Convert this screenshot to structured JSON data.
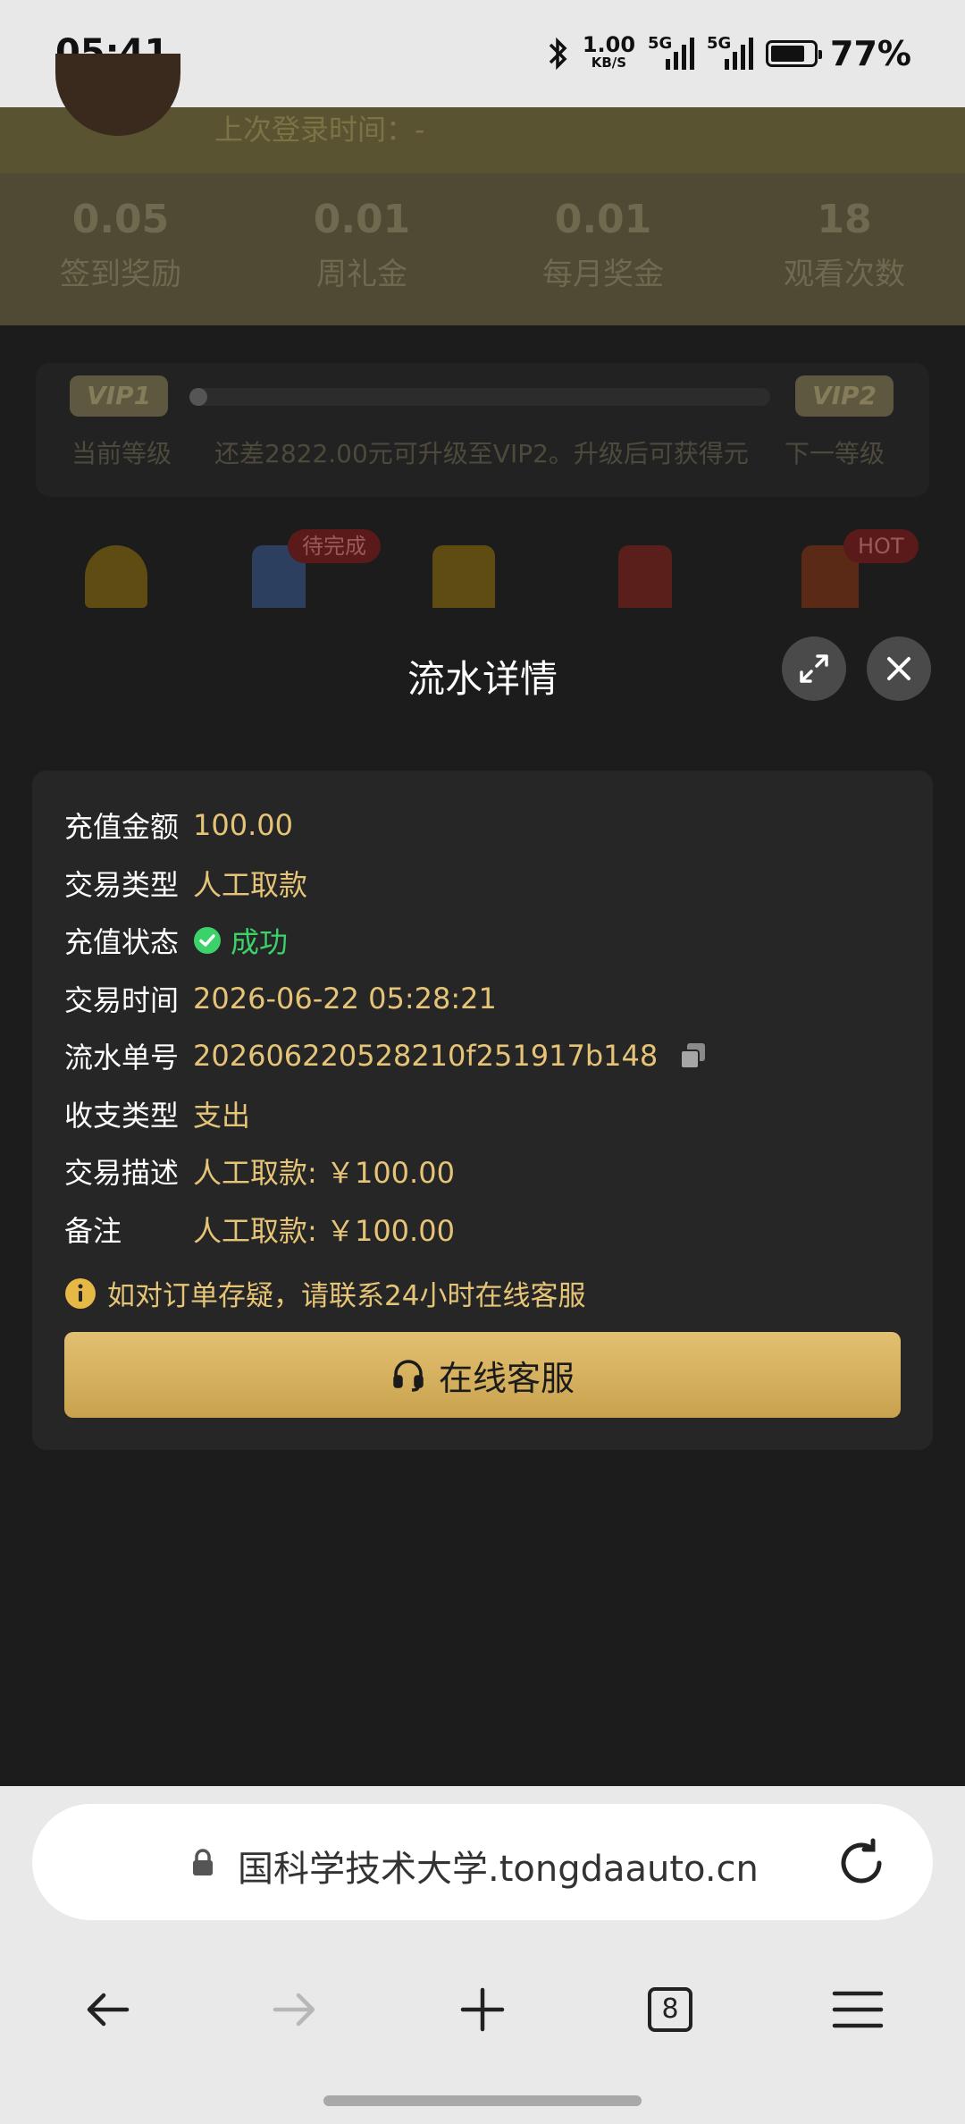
{
  "status_bar": {
    "time": "05:41",
    "net_speed": "1.00",
    "net_unit": "KB/S",
    "sim1": "5G",
    "sim2": "5G",
    "battery": "77%"
  },
  "background": {
    "last_login": "上次登录时间：-",
    "stats": [
      {
        "value": "0.05",
        "label": "签到奖励"
      },
      {
        "value": "0.01",
        "label": "周礼金"
      },
      {
        "value": "0.01",
        "label": "每月奖金"
      },
      {
        "value": "18",
        "label": "观看次数"
      }
    ],
    "vip": {
      "current_badge": "VIP1",
      "next_badge": "VIP2",
      "current_label": "当前等级",
      "progress_text": "还差2822.00元可升级至VIP2。升级后可获得元",
      "next_label": "下一等级",
      "progress": 0.03
    },
    "tags": {
      "pending": "待完成",
      "hot": "HOT"
    }
  },
  "modal": {
    "title": "流水详情",
    "rows": [
      {
        "key": "充值金额",
        "value": "100.00"
      },
      {
        "key": "交易类型",
        "value": "人工取款"
      },
      {
        "key": "充值状态",
        "value": "成功"
      },
      {
        "key": "交易时间",
        "value": "2026-06-22 05:28:21"
      },
      {
        "key": "流水单号",
        "value": "202606220528210f251917b148"
      },
      {
        "key": "收支类型",
        "value": "支出"
      },
      {
        "key": "交易描述",
        "value": "人工取款: ￥100.00"
      },
      {
        "key": "备注",
        "value": "人工取款: ￥100.00"
      }
    ],
    "notice": "如对订单存疑，请联系24小时在线客服",
    "cs_button": "在线客服"
  },
  "browser": {
    "url": "国科学技术大学.tongdaauto.cn",
    "tab_count": "8"
  },
  "colors": {
    "accent": "#e6c477",
    "success": "#3cd26a",
    "button_gold": "#d4b060"
  }
}
